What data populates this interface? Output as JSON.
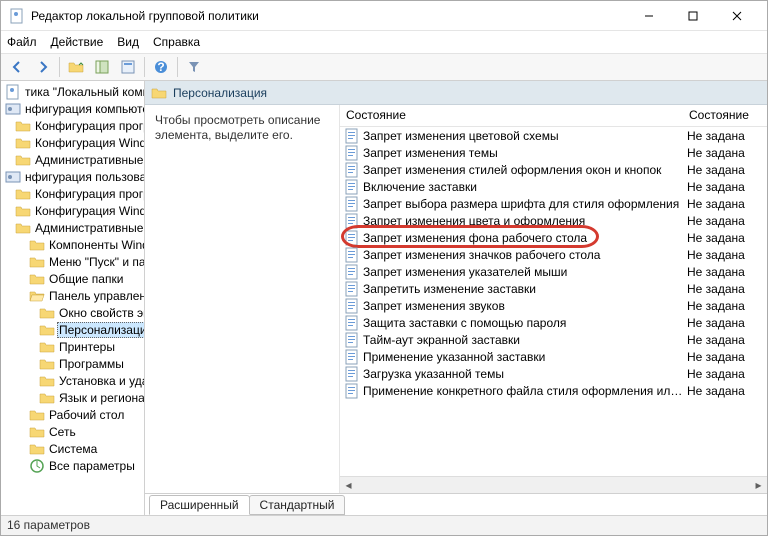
{
  "window": {
    "title": "Редактор локальной групповой политики"
  },
  "menu": {
    "file": "Файл",
    "action": "Действие",
    "view": "Вид",
    "help": "Справка"
  },
  "tree": [
    {
      "label": "тика \"Локальный компьюте",
      "depth": 0,
      "icon": "root"
    },
    {
      "label": "нфигурация компьютера",
      "depth": 0,
      "icon": "config"
    },
    {
      "label": "Конфигурация программ",
      "depth": 1,
      "icon": "folder"
    },
    {
      "label": "Конфигурация Windows",
      "depth": 1,
      "icon": "folder"
    },
    {
      "label": "Административные шабло",
      "depth": 1,
      "icon": "folder"
    },
    {
      "label": "нфигурация пользователя",
      "depth": 0,
      "icon": "config"
    },
    {
      "label": "Конфигурация программ",
      "depth": 1,
      "icon": "folder"
    },
    {
      "label": "Конфигурация Windows",
      "depth": 1,
      "icon": "folder"
    },
    {
      "label": "Административные шабло",
      "depth": 1,
      "icon": "folder"
    },
    {
      "label": "Компоненты Windows",
      "depth": 2,
      "icon": "folder"
    },
    {
      "label": "Меню \"Пуск\" и панель",
      "depth": 2,
      "icon": "folder"
    },
    {
      "label": "Общие папки",
      "depth": 2,
      "icon": "folder"
    },
    {
      "label": "Панель управления",
      "depth": 2,
      "icon": "folder-open"
    },
    {
      "label": "Окно свойств экран",
      "depth": 3,
      "icon": "folder"
    },
    {
      "label": "Персонализация",
      "depth": 3,
      "icon": "folder",
      "selected": true
    },
    {
      "label": "Принтеры",
      "depth": 3,
      "icon": "folder"
    },
    {
      "label": "Программы",
      "depth": 3,
      "icon": "folder"
    },
    {
      "label": "Установка и удален",
      "depth": 3,
      "icon": "folder"
    },
    {
      "label": "Язык и региональн",
      "depth": 3,
      "icon": "folder"
    },
    {
      "label": "Рабочий стол",
      "depth": 2,
      "icon": "folder"
    },
    {
      "label": "Сеть",
      "depth": 2,
      "icon": "folder"
    },
    {
      "label": "Система",
      "depth": 2,
      "icon": "folder"
    },
    {
      "label": "Все параметры",
      "depth": 2,
      "icon": "all"
    }
  ],
  "header": {
    "title": "Персонализация"
  },
  "desc": "Чтобы просмотреть описание элемента, выделите его.",
  "columns": {
    "name": "Состояние",
    "state": "Состояние"
  },
  "policies": [
    {
      "name": "Запрет изменения цветовой схемы",
      "state": "Не задана"
    },
    {
      "name": "Запрет изменения темы",
      "state": "Не задана"
    },
    {
      "name": "Запрет изменения стилей оформления окон и кнопок",
      "state": "Не задана"
    },
    {
      "name": "Включение заставки",
      "state": "Не задана"
    },
    {
      "name": "Запрет выбора размера шрифта для стиля оформления",
      "state": "Не задана"
    },
    {
      "name": "Запрет изменения цвета и оформления",
      "state": "Не задана"
    },
    {
      "name": "Запрет изменения фона рабочего стола",
      "state": "Не задана",
      "ring": true
    },
    {
      "name": "Запрет изменения значков рабочего стола",
      "state": "Не задана"
    },
    {
      "name": "Запрет изменения указателей мыши",
      "state": "Не задана"
    },
    {
      "name": "Запретить изменение заставки",
      "state": "Не задана"
    },
    {
      "name": "Запрет изменения звуков",
      "state": "Не задана"
    },
    {
      "name": "Защита заставки с помощью пароля",
      "state": "Не задана"
    },
    {
      "name": "Тайм-аут экранной заставки",
      "state": "Не задана"
    },
    {
      "name": "Применение указанной заставки",
      "state": "Не задана"
    },
    {
      "name": "Загрузка указанной темы",
      "state": "Не задана"
    },
    {
      "name": "Применение конкретного файла стиля оформления или...",
      "state": "Не задана"
    }
  ],
  "tabs": {
    "extended": "Расширенный",
    "standard": "Стандартный"
  },
  "status": "16 параметров"
}
